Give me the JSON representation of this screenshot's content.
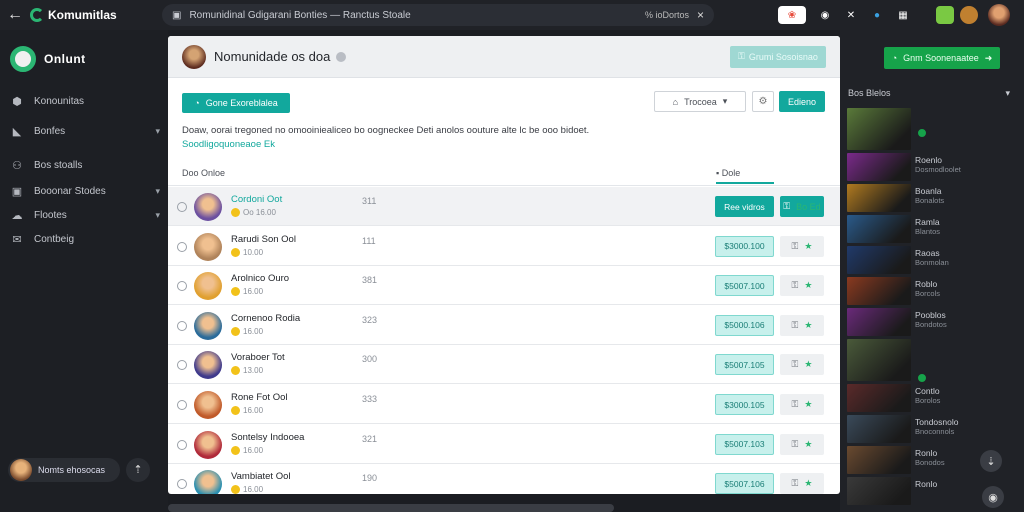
{
  "topbar": {
    "back_icon": "arrow-left-icon",
    "app_name": "Komumitlas",
    "url": "Romunidinal Gdigarani Bonties  —  Ranctus Stoale",
    "url_extra": "% ioDortos",
    "close": "×"
  },
  "sidebar": {
    "title": "Onlunt",
    "items": [
      {
        "label": "Konounitas",
        "icon": "community-icon",
        "chevron": ""
      },
      {
        "label": "Bonfes",
        "icon": "tag-icon",
        "chevron": "▾"
      },
      {
        "label": "Bos stoalls",
        "icon": "users-icon",
        "chevron": ""
      },
      {
        "label": "Booonar Stodes",
        "icon": "image-icon",
        "chevron": "▾"
      },
      {
        "label": "Flootes",
        "icon": "cloud-icon",
        "chevron": "▾"
      },
      {
        "label": "Contbeig",
        "icon": "mail-icon",
        "chevron": ""
      }
    ],
    "user_label": "Nomts ehosocas"
  },
  "main": {
    "group_title": "Nomunidade os doa",
    "header_button": "Grumi Sosoisnao",
    "join_button": "Gone Exoreblalea",
    "sort_label": "Trocoea",
    "sort_chevron": "▾",
    "search_button": "Edieno",
    "description": "Doaw, oorai tregoned  no omooiniealiceo  bo oogneckee  Deti anolos  oouture alte  lc  be  ooo bidoet.",
    "description_link": "Soodligoquoneaoe  Ek",
    "list_header_left": "Doo Onloe",
    "list_header_right": "Dole",
    "rows": [
      {
        "name": "Cordoni Oot",
        "sub": "Oo 16.00",
        "num": "311",
        "price": "Ree vidros",
        "action": "Bo  Ed",
        "selected": true,
        "avatar": "#6b4fa0"
      },
      {
        "name": "Rarudi Son Ool",
        "sub": "10.00",
        "num": "111",
        "price": "$3000.100",
        "action": "★",
        "selected": false,
        "avatar": "#b0835a"
      },
      {
        "name": "Arolnico Ouro",
        "sub": "16.00",
        "num": "381",
        "price": "$5007.100",
        "action": "★",
        "selected": false,
        "avatar": "#e0a030"
      },
      {
        "name": "Cornenoo Rodia",
        "sub": "16.00",
        "num": "323",
        "price": "$5000.106",
        "action": "★",
        "selected": false,
        "avatar": "#2a6b9a"
      },
      {
        "name": "Voraboer Tot",
        "sub": "13.00",
        "num": "300",
        "price": "$5007.105",
        "action": "★",
        "selected": false,
        "avatar": "#3f3a8c"
      },
      {
        "name": "Rone Fot Ool",
        "sub": "16.00",
        "num": "333",
        "price": "$3000.105",
        "action": "★",
        "selected": false,
        "avatar": "#c05a2a"
      },
      {
        "name": "Sontelsy Indooea",
        "sub": "16.00",
        "num": "321",
        "price": "$5007.103",
        "action": "★",
        "selected": false,
        "avatar": "#b02a3a"
      },
      {
        "name": "Vambiatet Ool",
        "sub": "16.00",
        "num": "190",
        "price": "$5007.106",
        "action": "★",
        "selected": false,
        "avatar": "#2a8fb0"
      }
    ]
  },
  "right_panel": {
    "button": "Gnm Soonenaatee",
    "header": "Bos Blelos",
    "chevron": "▾",
    "items": [
      {
        "label": "",
        "sub": "",
        "color": "#5a7a3a",
        "big": true
      },
      {
        "label": "Roenlo",
        "sub": "Dosmodloolet",
        "color": "#7a2a8a"
      },
      {
        "label": "Boanla",
        "sub": "Bonalots",
        "color": "#b07a20"
      },
      {
        "label": "Ramla",
        "sub": "Blantos",
        "color": "#2a5a8a"
      },
      {
        "label": "Raoas",
        "sub": "Bonmolan",
        "color": "#203a6a"
      },
      {
        "label": "Roblo",
        "sub": "Borcols",
        "color": "#8a3a20"
      },
      {
        "label": "Pooblos",
        "sub": "Bondotos",
        "color": "#6a2a7a"
      },
      {
        "label": "",
        "sub": "",
        "color": "#4a5a3a",
        "big": true
      },
      {
        "label": "Contlo",
        "sub": "Borolos",
        "color": "#5a2a2a"
      },
      {
        "label": "Tondosnolo",
        "sub": "Bnoconnols",
        "color": "#3a4a5a"
      },
      {
        "label": "Ronlo",
        "sub": "Bonodos",
        "color": "#6a4a30"
      },
      {
        "label": "Ronlo",
        "sub": "",
        "color": "#3a3a3a"
      }
    ]
  }
}
